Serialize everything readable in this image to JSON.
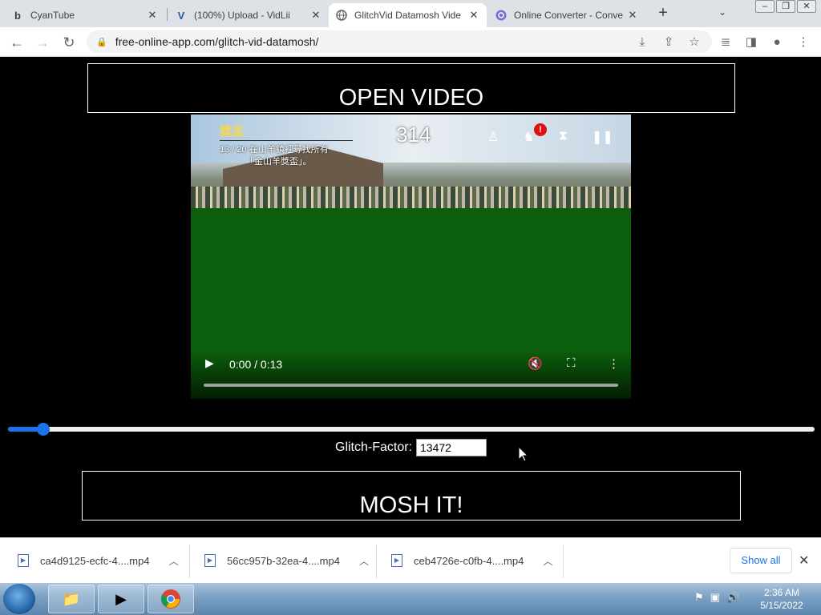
{
  "browser": {
    "tabs": [
      {
        "title": "CyanTube",
        "favicon": "b",
        "favicon_color": "#000000"
      },
      {
        "title": "(100%) Upload - VidLii",
        "favicon": "V",
        "favicon_color": "#1e5fa8"
      },
      {
        "title": "GlitchVid Datamosh Vide",
        "favicon": "globe-icon",
        "active": true
      },
      {
        "title": "Online Converter - Conve",
        "favicon": "converter-icon"
      }
    ],
    "close_glyph": "✕",
    "new_tab_glyph": "+",
    "tab_search_glyph": "⌄",
    "url": "free-online-app.com/glitch-vid-datamosh/"
  },
  "page": {
    "open_button": "OPEN VIDEO",
    "mosh_button": "MOSH IT!",
    "glitch_label": "Glitch-Factor:",
    "glitch_value": "13472",
    "slider_level": 0.04,
    "accent_color": "#1a73e8"
  },
  "video": {
    "hud_title": "獎盃",
    "hud_sub1": "13 / 20 在山羊鎮裡尋找所有",
    "hud_sub2": "「金山羊獎盃」。",
    "hud_number": "314",
    "hud_alert": "!",
    "time": "0:00 / 0:13",
    "progress": 0.0
  },
  "downloads": {
    "items": [
      {
        "name": "ca4d9125-ecfc-4....mp4"
      },
      {
        "name": "56cc957b-32ea-4....mp4"
      },
      {
        "name": "ceb4726e-c0fb-4....mp4"
      }
    ],
    "show_all": "Show all"
  },
  "taskbar": {
    "time": "2:36 AM",
    "date": "5/15/2022"
  }
}
